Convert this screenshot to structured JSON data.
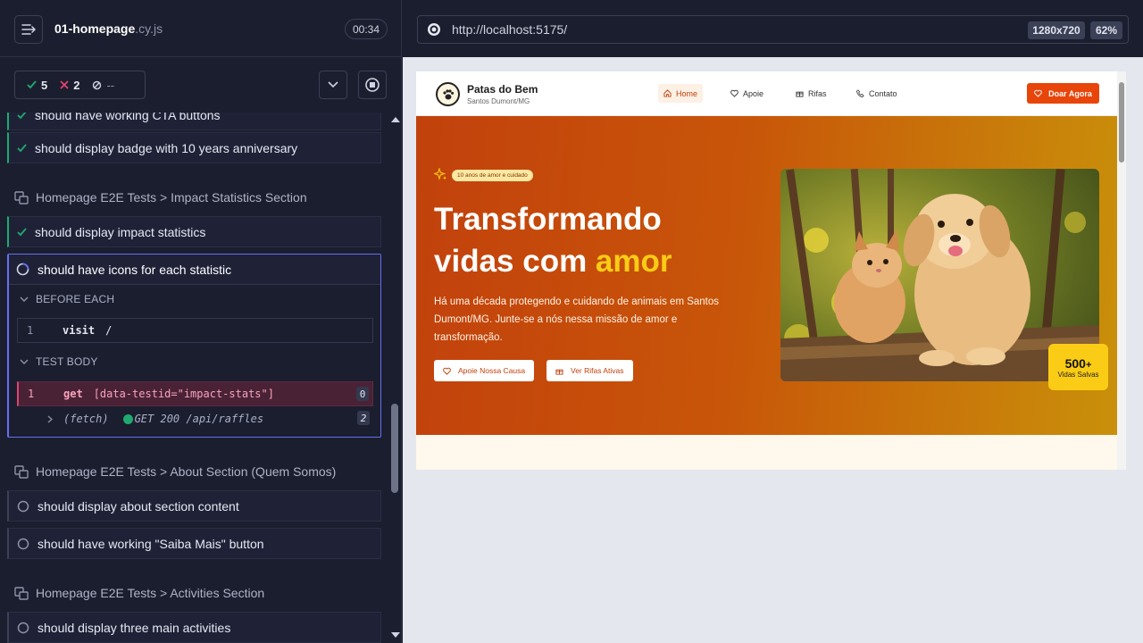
{
  "reporter": {
    "spec_name": "01-homepage",
    "spec_ext": ".cy.js",
    "duration": "00:34",
    "passed": "5",
    "failed": "2",
    "pending": "--"
  },
  "tests": {
    "t0": "should have working CTA buttons",
    "t1": "should display badge with 10 years anniversary",
    "suite1": "Homepage E2E Tests > Impact Statistics Section",
    "t2": "should display impact statistics",
    "t3": "should have icons for each statistic",
    "before_each": "BEFORE EACH",
    "cmd1_num": "1",
    "cmd1_name": "visit",
    "cmd1_arg": "/",
    "test_body": "TEST BODY",
    "cmd2_num": "1",
    "cmd2_name": "get",
    "cmd2_arg": "[data-testid=\"impact-stats\"]",
    "cmd2_count": "0",
    "fetch_label": "(fetch)",
    "fetch_text": "GET 200 /api/raffles",
    "fetch_count": "2",
    "suite2": "Homepage E2E Tests > About Section (Quem Somos)",
    "t4": "should display about section content",
    "t5": "should have working \"Saiba Mais\" button",
    "suite3": "Homepage E2E Tests > Activities Section",
    "t6": "should display three main activities"
  },
  "preview": {
    "url": "http://localhost:5175/",
    "viewport": "1280x720",
    "zoom": "62%"
  },
  "site": {
    "brand": "Patas do Bem",
    "location": "Santos Dumont/MG",
    "nav": [
      "Home",
      "Apoie",
      "Rifas",
      "Contato"
    ],
    "donate": "Doar Agora",
    "pill": "10 anos de amor e cuidado",
    "h1_line1": "Transformando",
    "h1_line2a": "vidas com ",
    "h1_line2b": "amor",
    "lead": "Há uma década protegendo e cuidando de animais em Santos Dumont/MG. Junte-se a nós nessa missão de amor e transformação.",
    "btn1": "Apoie Nossa Causa",
    "btn2": "Ver Rifas Ativas",
    "stat_value": "500",
    "stat_plus": "+",
    "stat_label": "Vidas Salvas"
  },
  "colors": {
    "pass": "#1fa971",
    "fail": "#e0436f",
    "accent": "#6470f0",
    "brand_orange": "#e8450a",
    "highlight": "#facc15"
  }
}
